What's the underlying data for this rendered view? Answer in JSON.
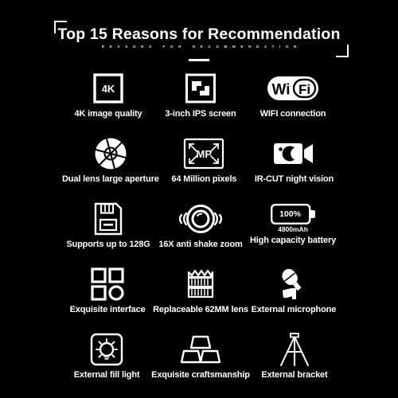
{
  "poster": {
    "background_color": "#000000",
    "foreground_color": "#ffffff",
    "header": {
      "title": "Top 15 Reasons for Recommendation",
      "subtitle": "REASONS FOR RECOMMENDATION"
    },
    "features": [
      {
        "icon": "4k-box-icon",
        "icon_text": "4K",
        "label": "4K image quality",
        "sub_label": ""
      },
      {
        "icon": "screen-corners-icon",
        "icon_text": "",
        "label": "3-inch IPS screen",
        "sub_label": ""
      },
      {
        "icon": "wifi-pill-icon",
        "icon_text": "Wi Fi",
        "label": "WIFI connection",
        "sub_label": ""
      },
      {
        "icon": "aperture-icon",
        "icon_text": "",
        "label": "Dual lens large aperture",
        "sub_label": ""
      },
      {
        "icon": "megapixel-box-icon",
        "icon_text": "MP",
        "label": "64 Million pixels",
        "sub_label": ""
      },
      {
        "icon": "night-vision-camera-icon",
        "icon_text": "",
        "label": "IR-CUT night vision",
        "sub_label": ""
      },
      {
        "icon": "sd-card-icon",
        "icon_text": "",
        "label": "Supports up to 128G",
        "sub_label": ""
      },
      {
        "icon": "anti-shake-lens-icon",
        "icon_text": "",
        "label": "16X anti shake zoom",
        "sub_label": ""
      },
      {
        "icon": "battery-icon",
        "icon_text": "100%",
        "label": "High capacity battery",
        "sub_label": "4800mAh"
      },
      {
        "icon": "interface-grid-icon",
        "icon_text": "",
        "label": "Exquisite interface",
        "sub_label": ""
      },
      {
        "icon": "camera-lens-icon",
        "icon_text": "",
        "label": "Replaceable 62MM lens",
        "sub_label": ""
      },
      {
        "icon": "microphone-icon",
        "icon_text": "",
        "label": "External microphone",
        "sub_label": ""
      },
      {
        "icon": "fill-light-bulb-icon",
        "icon_text": "",
        "label": "External fill light",
        "sub_label": ""
      },
      {
        "icon": "craftsmanship-blocks-icon",
        "icon_text": "",
        "label": "Exquisite craftsmanship",
        "sub_label": ""
      },
      {
        "icon": "tripod-icon",
        "icon_text": "",
        "label": "External bracket",
        "sub_label": ""
      }
    ]
  }
}
